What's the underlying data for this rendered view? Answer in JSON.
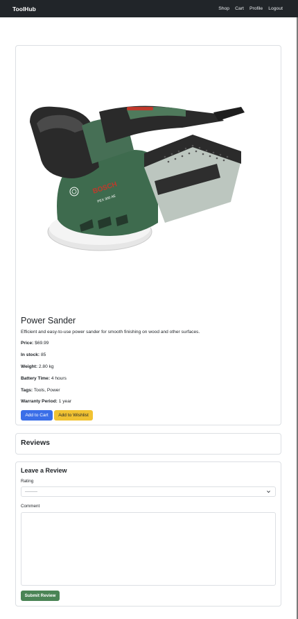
{
  "nav": {
    "brand": "ToolHub",
    "links": [
      "Shop",
      "Cart",
      "Profile",
      "Logout"
    ]
  },
  "product": {
    "image_alt": "Power sander (green and black, BOSCH PEX 300 AE)",
    "image_brand_text": "BOSCH",
    "image_model_text": "PEX 300 AE",
    "title": "Power Sander",
    "description": "Efficient and easy-to-use power sander for smooth finishing on wood and other surfaces.",
    "attributes": [
      {
        "label": "Price:",
        "value": "$69.99"
      },
      {
        "label": "In stock:",
        "value": "85"
      },
      {
        "label": "Weight:",
        "value": "2.80 kg"
      },
      {
        "label": "Battery Time:",
        "value": "4 hours"
      },
      {
        "label": "Tags:",
        "value": "Tools, Power"
      },
      {
        "label": "Warranty Period:",
        "value": "1 year"
      }
    ],
    "add_to_cart_label": "Add to Cart",
    "add_to_wishlist_label": "Add to Wishlist"
  },
  "reviews": {
    "title": "Reviews"
  },
  "review_form": {
    "title": "Leave a Review",
    "rating_label": "Rating",
    "rating_selected": "---------",
    "comment_label": "Comment",
    "submit_label": "Submit Review"
  },
  "colors": {
    "navbar_bg": "#212529",
    "primary": "#3a6ee8",
    "warning": "#f1c232",
    "success": "#4a8455"
  }
}
